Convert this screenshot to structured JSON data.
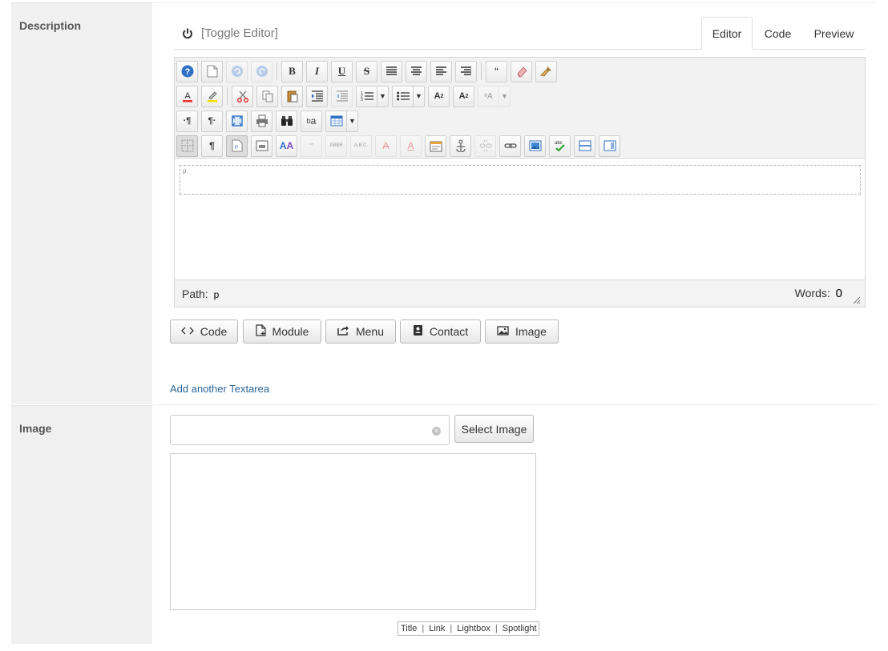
{
  "description": {
    "label": "Description",
    "toggle_label": "[Toggle Editor]",
    "tabs": [
      {
        "label": "Editor",
        "active": true
      },
      {
        "label": "Code",
        "active": false
      },
      {
        "label": "Preview",
        "active": false
      }
    ],
    "toolbar": {
      "paragraph_tag": "p"
    },
    "statusbar": {
      "path_label": "Path:",
      "path_value": "p",
      "words_label": "Words:",
      "words_value": "0"
    },
    "buttons": [
      {
        "label": "Code",
        "icon": "code-icon"
      },
      {
        "label": "Module",
        "icon": "file-plus-icon"
      },
      {
        "label": "Menu",
        "icon": "share-icon"
      },
      {
        "label": "Contact",
        "icon": "address-book-icon"
      },
      {
        "label": "Image",
        "icon": "picture-icon"
      }
    ],
    "add_textarea_label": "Add another Textarea"
  },
  "image": {
    "label": "Image",
    "input_value": "",
    "select_button_label": "Select Image",
    "links": [
      "Title",
      "Link",
      "Lightbox",
      "Spotlight"
    ]
  },
  "colors": {
    "link": "#2a6496",
    "label_bg": "#f0f0f0",
    "help_icon": "#2f6fc4"
  }
}
